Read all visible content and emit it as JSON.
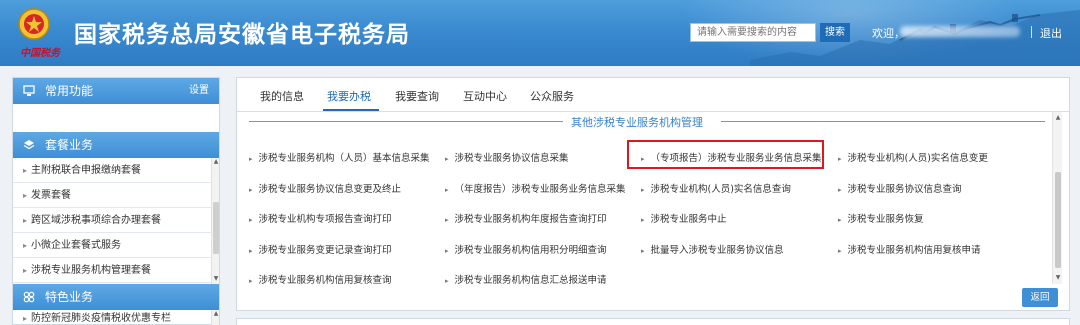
{
  "header": {
    "title": "国家税务总局安徽省电子税务局",
    "brand": "中国税务",
    "search_placeholder": "请输入需要搜索的内容",
    "search_button": "搜索",
    "welcome": "欢迎，",
    "logout": "退出"
  },
  "sidebar": {
    "common": {
      "title": "常用功能",
      "settings": "设置",
      "icon": "monitor-icon"
    },
    "package": {
      "title": "套餐业务",
      "icon": "layers-icon",
      "items": [
        "主附税联合申报缴纳套餐",
        "发票套餐",
        "跨区域涉税事项综合办理套餐",
        "小微企业套餐式服务",
        "涉税专业服务机构管理套餐"
      ]
    },
    "featured": {
      "title": "特色业务",
      "icon": "features-icon",
      "items": [
        "防控新冠肺炎疫情税收优惠专栏"
      ]
    }
  },
  "tabs": [
    "我的信息",
    "我要办税",
    "我要查询",
    "互动中心",
    "公众服务"
  ],
  "active_tab": "我要办税",
  "section_title": "其他涉税专业服务机构管理",
  "links": {
    "row1": [
      "涉税专业服务机构（人员）基本信息采集",
      "涉税专业服务协议信息采集",
      "（专项报告）涉税专业服务业务信息采集",
      "涉税专业机构(人员)实名信息变更"
    ],
    "row2": [
      "涉税专业服务协议信息变更及终止",
      "（年度报告）涉税专业服务业务信息采集",
      "涉税专业机构(人员)实名信息查询",
      "涉税专业服务协议信息查询"
    ],
    "row3": [
      "涉税专业机构专项报告查询打印",
      "涉税专业服务机构年度报告查询打印",
      "涉税专业服务中止",
      "涉税专业服务恢复"
    ],
    "row4": [
      "涉税专业服务变更记录查询打印",
      "涉税专业服务机构信用积分明细查询",
      "批量导入涉税专业服务协议信息",
      "涉税专业服务机构信用复核申请"
    ],
    "row5": [
      "涉税专业服务机构信用复核查询",
      "涉税专业服务机构信息汇总报送申请"
    ]
  },
  "back_button": "返回",
  "colors": {
    "accent": "#1e6bb8",
    "highlight": "#e0181e",
    "header": "#3a8ad0"
  }
}
